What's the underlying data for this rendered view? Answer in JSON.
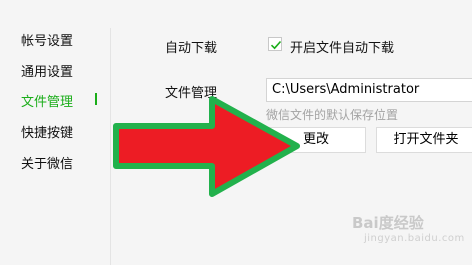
{
  "sidebar": {
    "items": [
      {
        "label": "帐号设置",
        "active": false
      },
      {
        "label": "通用设置",
        "active": false
      },
      {
        "label": "文件管理",
        "active": true
      },
      {
        "label": "快捷按键",
        "active": false
      },
      {
        "label": "关于微信",
        "active": false
      }
    ]
  },
  "main": {
    "auto_download": {
      "label": "自动下载",
      "checkbox_label": "开启文件自动下载",
      "checked": true
    },
    "file_management": {
      "label": "文件管理",
      "path_value": "C:\\Users\\Administrator",
      "hint": "微信文件的默认保存位置",
      "change_button": "更改",
      "open_folder_button": "打开文件夹"
    }
  },
  "watermark": {
    "text": "Bai度经验",
    "sub": "jingyan.baidu.com"
  },
  "colors": {
    "accent": "#1aad19",
    "arrow_fill": "#ed1c24",
    "arrow_border": "#22b14c"
  }
}
